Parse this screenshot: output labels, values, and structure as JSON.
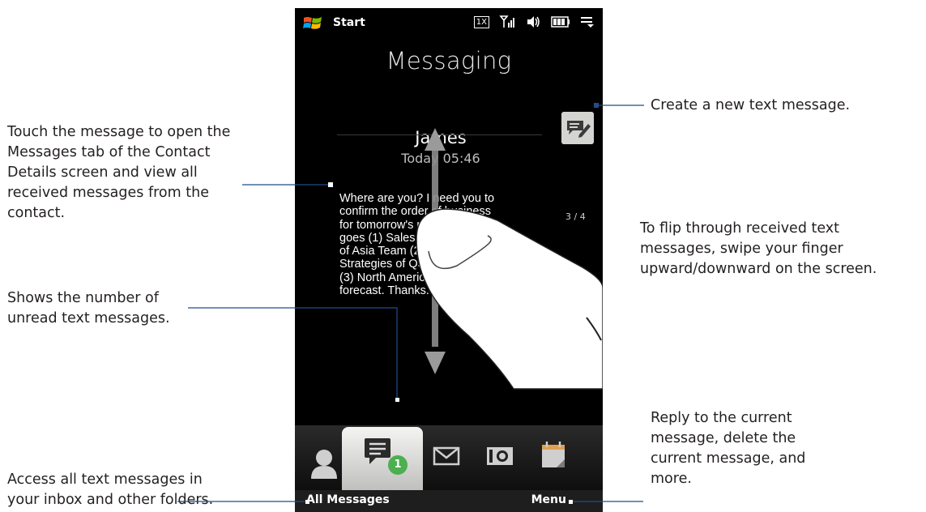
{
  "phone": {
    "status_title": "Start",
    "status_1x": "1X",
    "tab_title": "Messaging",
    "sender": "James",
    "time": "Today 05:46",
    "message_lines": [
      "Where are you? I need you to",
      "confirm the order of business",
      "for tomorrow's meeting. Here",
      "goes (1) Sales presentation",
      "of Asia Team (2) Marketing",
      "Strategies of Q3 and",
      "(3) North America sales",
      "forecast. Thanks."
    ],
    "counter": "3 / 4",
    "unread_count": "1",
    "soft_left": "All Messages",
    "soft_right": "Menu"
  },
  "callouts": {
    "touch_message": [
      "Touch the message to open the",
      "Messages tab of the Contact",
      "Details screen and view all",
      "received messages from the",
      "contact."
    ],
    "unread": [
      "Shows the number of",
      "unread text messages."
    ],
    "access_all": [
      "Access all text messages in",
      "your inbox and other folders."
    ],
    "create_new": [
      "Create a new text message."
    ],
    "flip": [
      "To flip through received text",
      "messages, swipe your finger",
      "upward/downward on the screen."
    ],
    "reply": [
      "Reply to the current",
      "message, delete the",
      "current message, and",
      "more."
    ]
  },
  "colors": {
    "leader_line": "#1f4e8c",
    "badge_green": "#4caf50"
  }
}
